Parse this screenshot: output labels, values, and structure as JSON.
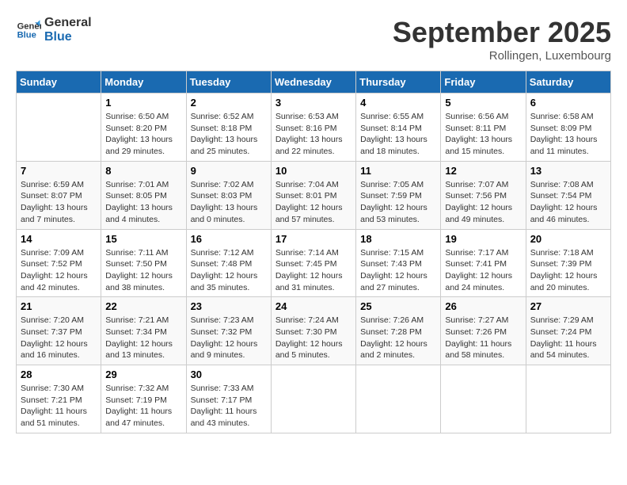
{
  "header": {
    "logo_line1": "General",
    "logo_line2": "Blue",
    "month": "September 2025",
    "location": "Rollingen, Luxembourg"
  },
  "weekdays": [
    "Sunday",
    "Monday",
    "Tuesday",
    "Wednesday",
    "Thursday",
    "Friday",
    "Saturday"
  ],
  "weeks": [
    [
      {
        "day": "",
        "info": ""
      },
      {
        "day": "1",
        "info": "Sunrise: 6:50 AM\nSunset: 8:20 PM\nDaylight: 13 hours\nand 29 minutes."
      },
      {
        "day": "2",
        "info": "Sunrise: 6:52 AM\nSunset: 8:18 PM\nDaylight: 13 hours\nand 25 minutes."
      },
      {
        "day": "3",
        "info": "Sunrise: 6:53 AM\nSunset: 8:16 PM\nDaylight: 13 hours\nand 22 minutes."
      },
      {
        "day": "4",
        "info": "Sunrise: 6:55 AM\nSunset: 8:14 PM\nDaylight: 13 hours\nand 18 minutes."
      },
      {
        "day": "5",
        "info": "Sunrise: 6:56 AM\nSunset: 8:11 PM\nDaylight: 13 hours\nand 15 minutes."
      },
      {
        "day": "6",
        "info": "Sunrise: 6:58 AM\nSunset: 8:09 PM\nDaylight: 13 hours\nand 11 minutes."
      }
    ],
    [
      {
        "day": "7",
        "info": "Sunrise: 6:59 AM\nSunset: 8:07 PM\nDaylight: 13 hours\nand 7 minutes."
      },
      {
        "day": "8",
        "info": "Sunrise: 7:01 AM\nSunset: 8:05 PM\nDaylight: 13 hours\nand 4 minutes."
      },
      {
        "day": "9",
        "info": "Sunrise: 7:02 AM\nSunset: 8:03 PM\nDaylight: 13 hours\nand 0 minutes."
      },
      {
        "day": "10",
        "info": "Sunrise: 7:04 AM\nSunset: 8:01 PM\nDaylight: 12 hours\nand 57 minutes."
      },
      {
        "day": "11",
        "info": "Sunrise: 7:05 AM\nSunset: 7:59 PM\nDaylight: 12 hours\nand 53 minutes."
      },
      {
        "day": "12",
        "info": "Sunrise: 7:07 AM\nSunset: 7:56 PM\nDaylight: 12 hours\nand 49 minutes."
      },
      {
        "day": "13",
        "info": "Sunrise: 7:08 AM\nSunset: 7:54 PM\nDaylight: 12 hours\nand 46 minutes."
      }
    ],
    [
      {
        "day": "14",
        "info": "Sunrise: 7:09 AM\nSunset: 7:52 PM\nDaylight: 12 hours\nand 42 minutes."
      },
      {
        "day": "15",
        "info": "Sunrise: 7:11 AM\nSunset: 7:50 PM\nDaylight: 12 hours\nand 38 minutes."
      },
      {
        "day": "16",
        "info": "Sunrise: 7:12 AM\nSunset: 7:48 PM\nDaylight: 12 hours\nand 35 minutes."
      },
      {
        "day": "17",
        "info": "Sunrise: 7:14 AM\nSunset: 7:45 PM\nDaylight: 12 hours\nand 31 minutes."
      },
      {
        "day": "18",
        "info": "Sunrise: 7:15 AM\nSunset: 7:43 PM\nDaylight: 12 hours\nand 27 minutes."
      },
      {
        "day": "19",
        "info": "Sunrise: 7:17 AM\nSunset: 7:41 PM\nDaylight: 12 hours\nand 24 minutes."
      },
      {
        "day": "20",
        "info": "Sunrise: 7:18 AM\nSunset: 7:39 PM\nDaylight: 12 hours\nand 20 minutes."
      }
    ],
    [
      {
        "day": "21",
        "info": "Sunrise: 7:20 AM\nSunset: 7:37 PM\nDaylight: 12 hours\nand 16 minutes."
      },
      {
        "day": "22",
        "info": "Sunrise: 7:21 AM\nSunset: 7:34 PM\nDaylight: 12 hours\nand 13 minutes."
      },
      {
        "day": "23",
        "info": "Sunrise: 7:23 AM\nSunset: 7:32 PM\nDaylight: 12 hours\nand 9 minutes."
      },
      {
        "day": "24",
        "info": "Sunrise: 7:24 AM\nSunset: 7:30 PM\nDaylight: 12 hours\nand 5 minutes."
      },
      {
        "day": "25",
        "info": "Sunrise: 7:26 AM\nSunset: 7:28 PM\nDaylight: 12 hours\nand 2 minutes."
      },
      {
        "day": "26",
        "info": "Sunrise: 7:27 AM\nSunset: 7:26 PM\nDaylight: 11 hours\nand 58 minutes."
      },
      {
        "day": "27",
        "info": "Sunrise: 7:29 AM\nSunset: 7:24 PM\nDaylight: 11 hours\nand 54 minutes."
      }
    ],
    [
      {
        "day": "28",
        "info": "Sunrise: 7:30 AM\nSunset: 7:21 PM\nDaylight: 11 hours\nand 51 minutes."
      },
      {
        "day": "29",
        "info": "Sunrise: 7:32 AM\nSunset: 7:19 PM\nDaylight: 11 hours\nand 47 minutes."
      },
      {
        "day": "30",
        "info": "Sunrise: 7:33 AM\nSunset: 7:17 PM\nDaylight: 11 hours\nand 43 minutes."
      },
      {
        "day": "",
        "info": ""
      },
      {
        "day": "",
        "info": ""
      },
      {
        "day": "",
        "info": ""
      },
      {
        "day": "",
        "info": ""
      }
    ]
  ]
}
